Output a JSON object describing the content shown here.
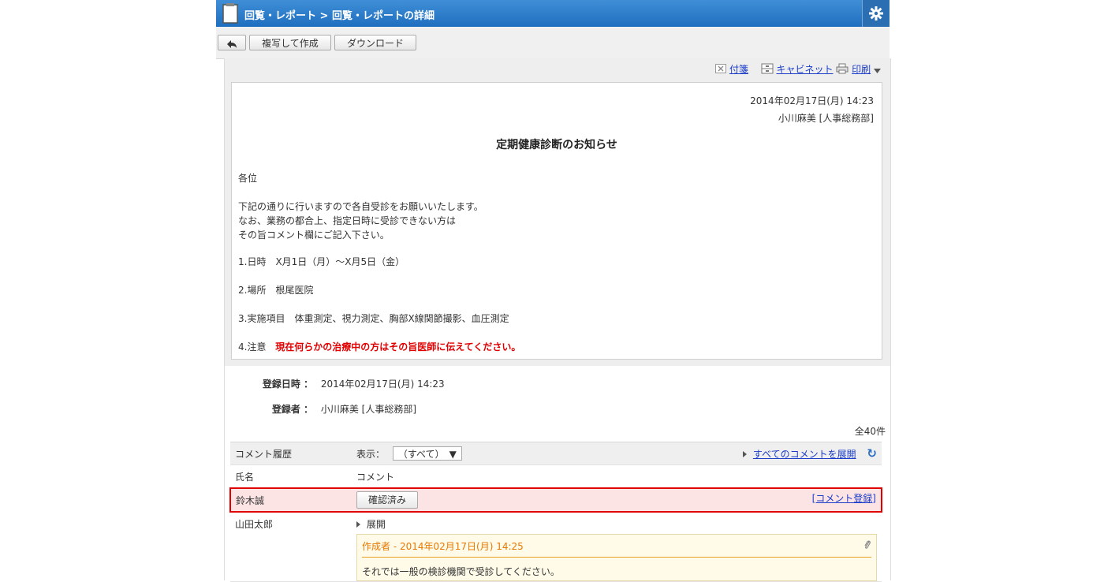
{
  "header": {
    "title": "回覧・レポート > 回覧・レポートの詳細"
  },
  "toolbar": {
    "copy_label": "複写して作成",
    "download_label": "ダウンロード"
  },
  "actions": {
    "sticky": "付箋",
    "cabinet": "キャビネット",
    "print": "印刷"
  },
  "report": {
    "date": "2014年02月17日(月) 14:23",
    "author": "小川麻美 [人事総務部]",
    "title": "定期健康診断のお知らせ",
    "greeting": "各位",
    "body1": "下記の通りに行いますので各自受診をお願いいたします。",
    "body2": "なお、業務の都合上、指定日時に受診できない方は",
    "body3": "その旨コメント欄にご記入下さい。",
    "item1": "1.日時　X月1日（月）～X月5日（金）",
    "item2": "2.場所　根尾医院",
    "item3": "3.実施項目　体重測定、視力測定、胸部X線関節撮影、血圧測定",
    "item4_prefix": "4.注意",
    "item4_note": "現在何らかの治療中の方はその旨医師に伝えてください。"
  },
  "meta": {
    "registered_label": "登録日時 ：",
    "registered_value": "2014年02月17日(月) 14:23",
    "registrant_label": "登録者 ：",
    "registrant_value": "小川麻美 [人事総務部]",
    "total": "全40件"
  },
  "comments": {
    "history_label": "コメント履歴",
    "display_label": "表示：",
    "display_value": "（すべて）",
    "expand_all": "すべてのコメントを展開",
    "col_name": "氏名",
    "col_comment": "コメント",
    "rows": [
      {
        "name": "鈴木誠",
        "button": "確認済み",
        "link": "[コメント登録]"
      },
      {
        "name": "山田太郎",
        "expand": "展開",
        "entry_head": "作成者  - 2014年02月17日(月) 14:25",
        "entry_body": "それでは一般の検診機関で受診してください。"
      }
    ]
  }
}
